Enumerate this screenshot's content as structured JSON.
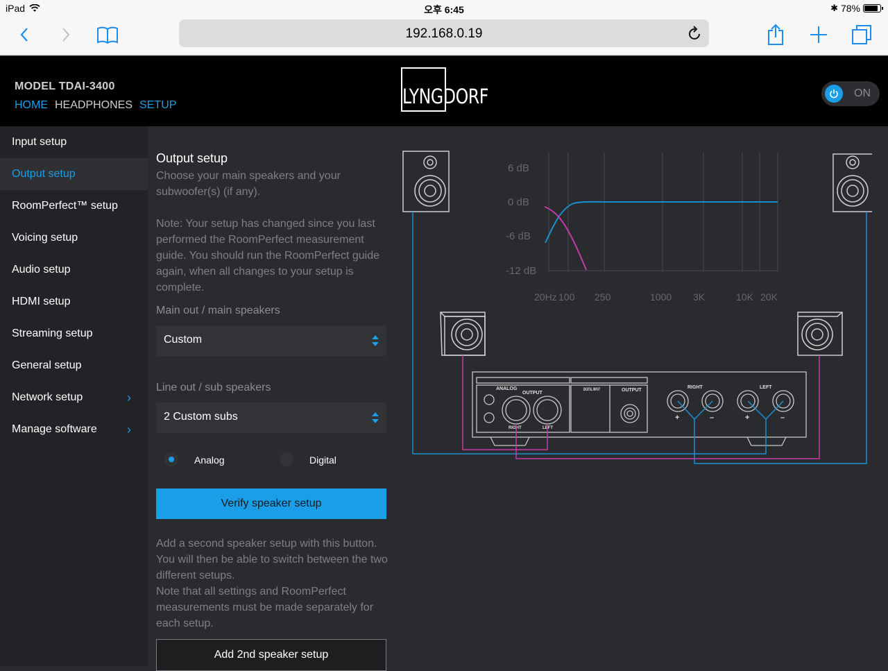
{
  "status_bar": {
    "device": "iPad",
    "time": "오후 6:45",
    "battery": "78%"
  },
  "browser": {
    "url": "192.168.0.19"
  },
  "header": {
    "model": "MODEL TDAI-3400",
    "nav": [
      "HOME",
      "HEADPHONES",
      "SETUP"
    ],
    "active_nav": "SETUP",
    "logo": "LYNGDORF",
    "power_label": "ON",
    "power_on": true
  },
  "sidebar": {
    "items": [
      {
        "label": "Input setup"
      },
      {
        "label": "Output setup",
        "active": true
      },
      {
        "label": "RoomPerfect™ setup"
      },
      {
        "label": "Voicing setup"
      },
      {
        "label": "Audio setup"
      },
      {
        "label": "HDMI setup"
      },
      {
        "label": "Streaming setup"
      },
      {
        "label": "General setup"
      },
      {
        "label": "Network setup",
        "chevron": true
      },
      {
        "label": "Manage software",
        "chevron": true
      }
    ]
  },
  "output_setup": {
    "title": "Output setup",
    "subtitle": "Choose your main speakers and your subwoofer(s) (if any).",
    "note": "Note: Your setup has changed since you last performed the RoomPerfect measurement guide. You should run the RoomPerfect guide again, when all changes to your setup is complete.",
    "main_out_label": "Main out / main speakers",
    "main_out_value": "Custom",
    "line_out_label": "Line out / sub speakers",
    "line_out_value": "2 Custom subs",
    "radio_analog": "Analog",
    "radio_digital": "Digital",
    "radio_selected": "Analog",
    "verify_button": "Verify speaker setup",
    "second_setup_text": "Add a second speaker setup with this button. You will then be able to switch between the two different setups.\nNote that all settings and RoomPerfect measurements must be made separately for each setup.",
    "add_button": "Add 2nd speaker setup"
  },
  "diagram": {
    "db_labels": [
      "6 dB",
      "0 dB",
      "-6 dB",
      "-12 dB"
    ],
    "freq_labels": [
      "20Hz",
      "100",
      "250",
      "1000",
      "3K",
      "10K",
      "20K"
    ],
    "panel_labels": {
      "analog": "ANALOG",
      "output": "OUTPUT",
      "right_xlr": "RIGHT",
      "left_xlr": "LEFT",
      "digital_input": "DIGITAL INPUT",
      "digital_output": "OUTPUT",
      "right_terminals": "RIGHT",
      "left_terminals": "LEFT",
      "plus": "+",
      "minus": "–"
    }
  },
  "colors": {
    "accent": "#1b9ee8",
    "magenta": "#d63bb0",
    "background": "#2a2b2e",
    "sidebar": "#222326",
    "header": "#000000"
  }
}
